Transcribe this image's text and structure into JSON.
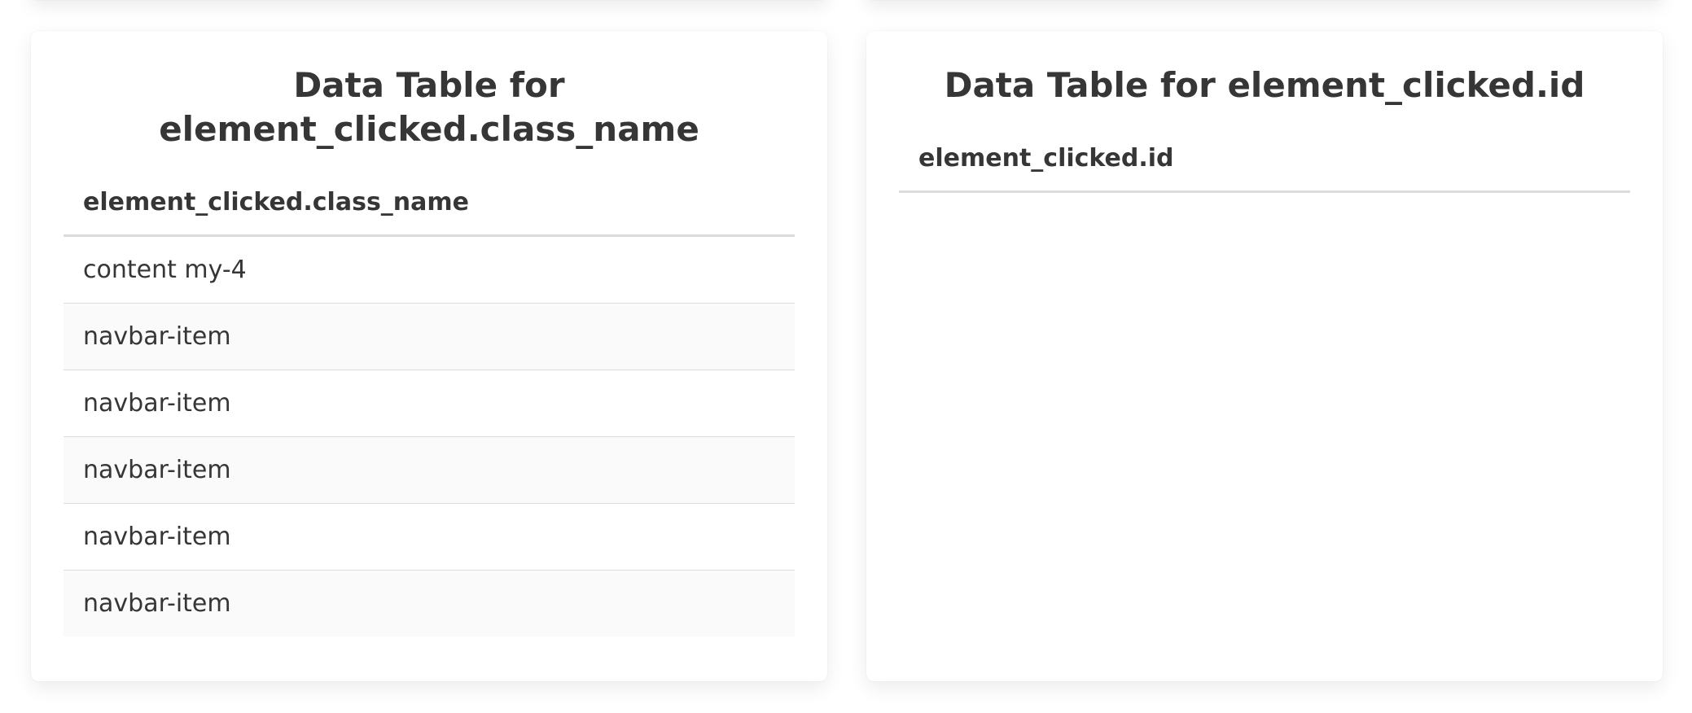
{
  "left_table": {
    "title_line1": "Data Table for",
    "title_line2": "element_clicked.class_name",
    "column_header": "element_clicked.class_name",
    "rows": [
      "content my-4",
      "navbar-item",
      "navbar-item",
      "navbar-item",
      "navbar-item",
      "navbar-item"
    ]
  },
  "right_table": {
    "title": "Data Table for element_clicked.id",
    "column_header": "element_clicked.id",
    "rows": []
  }
}
